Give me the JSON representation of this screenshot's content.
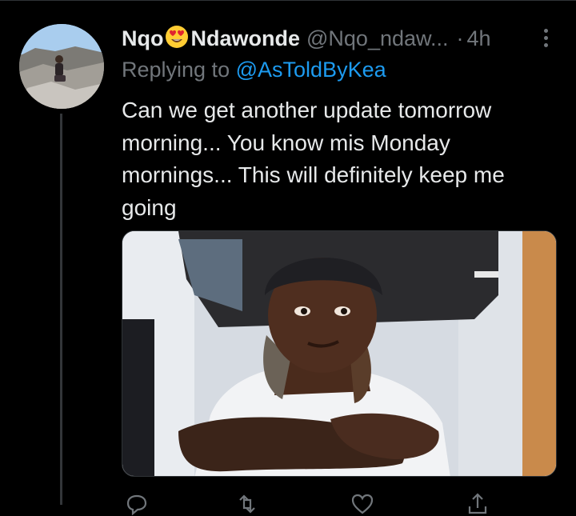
{
  "tweet": {
    "display_name_first": "Nqo",
    "display_name_emoji": "smiling-face-with-heart-eyes",
    "display_name_last": "Ndawonde",
    "handle": "@Nqo_ndaw...",
    "separator": "·",
    "time": "4h",
    "replying_prefix": "Replying to",
    "replying_to": "@AsToldByKea",
    "text": "Can we get another update tomorrow morning... You know mis Monday mornings... This will definitely keep me going"
  },
  "colors": {
    "background": "#000000",
    "text_primary": "#e7e9ea",
    "text_secondary": "#71767b",
    "link": "#1d9bf0",
    "border": "#2f3336"
  },
  "icons": {
    "more": "more-vertical-icon",
    "reply": "reply-icon",
    "retweet": "retweet-icon",
    "like": "heart-icon",
    "share": "share-icon"
  }
}
